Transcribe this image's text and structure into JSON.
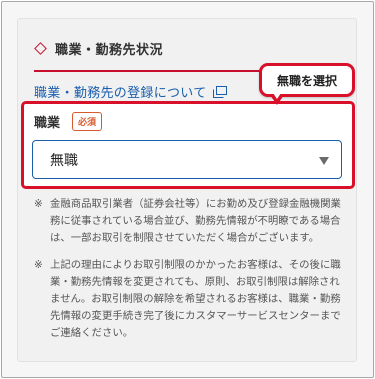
{
  "section": {
    "title": "職業・勤務先状況",
    "info_link": "職業・勤務先の登録について"
  },
  "callout": {
    "text": "無職を選択"
  },
  "field": {
    "label": "職業",
    "required_badge": "必須",
    "selected_value": "無職"
  },
  "notes": [
    {
      "mark": "※",
      "text": "金融商品取引業者（証券会社等）にお勤め及び登録金融機関業務に従事されている場合並び、勤務先情報が不明瞭である場合は、一部お取引を制限させていただく場合がございます。"
    },
    {
      "mark": "※",
      "text": "上記の理由によりお取引制限のかかったお客様は、その後に職業・勤務先情報を変更されても、原則、お取引制限は解除されません。お取引制限の解除を希望されるお客様は、職業・勤務先情報の変更手続き完了後にカスタマーサービスセンターまでご連絡ください。"
    }
  ],
  "colors": {
    "accent_red": "#c8102e",
    "link_blue": "#1a5fae",
    "badge_orange": "#d85a2a"
  }
}
